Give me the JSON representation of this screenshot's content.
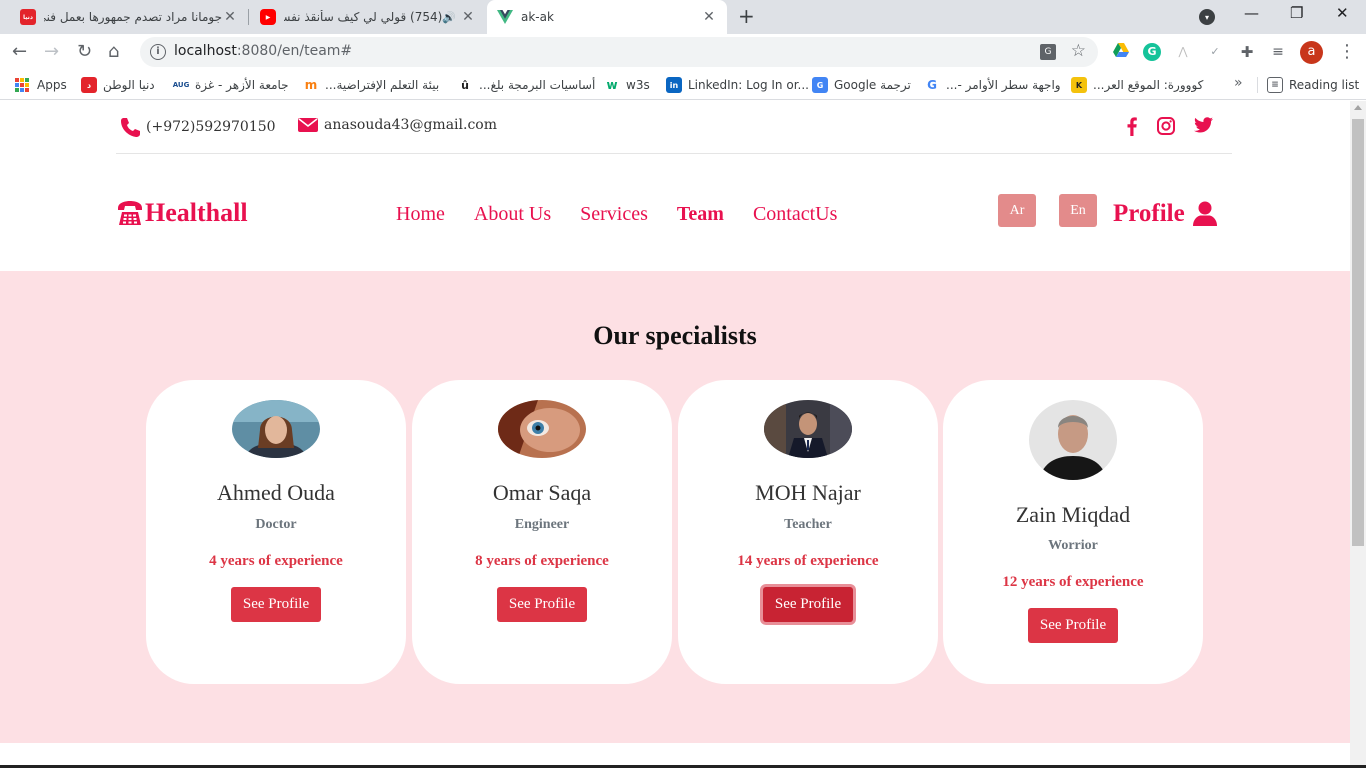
{
  "browser": {
    "tabs": [
      {
        "title": "جومانا مراد تصدم جمهورها بعمل فني"
      },
      {
        "title": "(754) قولي لي كيف سأنقذ نفسي"
      },
      {
        "title": "ak-ak"
      }
    ],
    "url_host": "localhost",
    "url_rest": ":8080/en/team#",
    "profile_initial": "a",
    "bookmarks": [
      {
        "label": "Apps"
      },
      {
        "label": "دنيا الوطن"
      },
      {
        "label": "جامعة الأزهر - غزة"
      },
      {
        "label": "بيئة التعلم الإفتراضية..."
      },
      {
        "label": "أساسيات البرمجة بلغ..."
      },
      {
        "label": "w3s"
      },
      {
        "label": "LinkedIn: Log In or..."
      },
      {
        "label": "Google ترجمة"
      },
      {
        "label": "واجهة سطر الأوامر -..."
      },
      {
        "label": "كووورة: الموقع العر..."
      }
    ],
    "reading_list": "Reading list"
  },
  "topbar": {
    "phone": "(+972)592970150",
    "email": "anasouda43@gmail.com"
  },
  "nav": {
    "brand": "Healthall",
    "links": [
      "Home",
      "About Us",
      "Services",
      "Team",
      "ContactUs"
    ],
    "lang_ar": "Ar",
    "lang_en": "En",
    "profile": "Profile"
  },
  "team": {
    "title": "Our specialists",
    "button_label": "See Profile",
    "members": [
      {
        "name": "Ahmed Ouda",
        "role": "Doctor",
        "experience": "4 years of experience"
      },
      {
        "name": "Omar Saqa",
        "role": "Engineer",
        "experience": "8 years of experience"
      },
      {
        "name": "MOH Najar",
        "role": "Teacher",
        "experience": "14 years of experience"
      },
      {
        "name": "Zain Miqdad",
        "role": "Worrior",
        "experience": "12 years of experience"
      }
    ]
  },
  "colors": {
    "brand": "#e8114f",
    "section_bg": "#fde0e4",
    "button": "#dc3545",
    "lang_button": "#e38b8b"
  }
}
